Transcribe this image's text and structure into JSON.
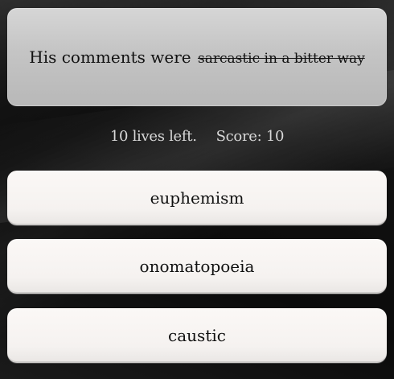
{
  "question": {
    "prefix": "His comments were",
    "struck_definition": "sarcastic in a bitter way"
  },
  "status": {
    "lives": "10 lives left.",
    "score": "Score: 10"
  },
  "answers": [
    {
      "label": "euphemism"
    },
    {
      "label": "onomatopoeia"
    },
    {
      "label": "caustic"
    }
  ]
}
